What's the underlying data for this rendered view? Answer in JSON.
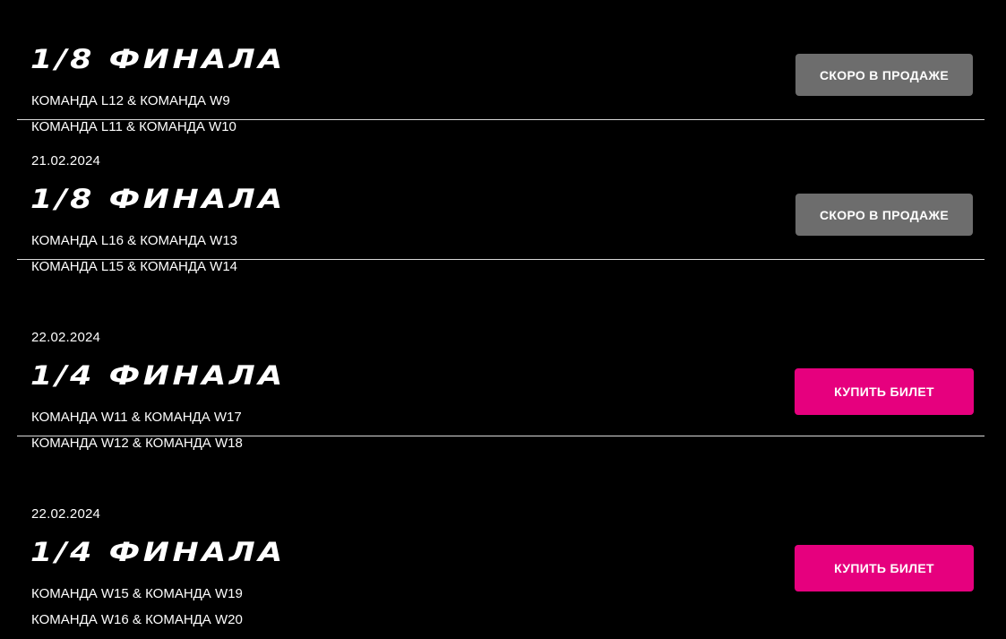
{
  "matches": [
    {
      "date": "",
      "stage": "1/8 ФИНАЛА",
      "teams": [
        "КОМАНДА L12 & КОМАНДА W9",
        "КОМАНДА L11 & КОМАНДА W10"
      ],
      "button": {
        "label": "СКОРО В ПРОДАЖЕ",
        "state": "coming-soon"
      }
    },
    {
      "date": "21.02.2024",
      "stage": "1/8 ФИНАЛА",
      "teams": [
        "КОМАНДА L16 & КОМАНДА W13",
        "КОМАНДА L15 & КОМАНДА W14"
      ],
      "button": {
        "label": "СКОРО В ПРОДАЖЕ",
        "state": "coming-soon"
      }
    },
    {
      "date": "22.02.2024",
      "stage": "1/4 ФИНАЛА",
      "teams": [
        "КОМАНДА W11 & КОМАНДА W17",
        "КОМАНДА W12 & КОМАНДА W18"
      ],
      "button": {
        "label": "КУПИТЬ БИЛЕТ",
        "state": "buy"
      }
    },
    {
      "date": "22.02.2024",
      "stage": "1/4 ФИНАЛА",
      "teams": [
        "КОМАНДА W15 & КОМАНДА W19",
        "КОМАНДА W16 & КОМАНДА W20"
      ],
      "button": {
        "label": "КУПИТЬ БИЛЕТ",
        "state": "buy"
      }
    }
  ],
  "colors": {
    "background": "#000000",
    "text": "#ffffff",
    "divider": "#d8d8d8",
    "button_soon": "#6d6d6d",
    "button_buy": "#e6007e"
  }
}
